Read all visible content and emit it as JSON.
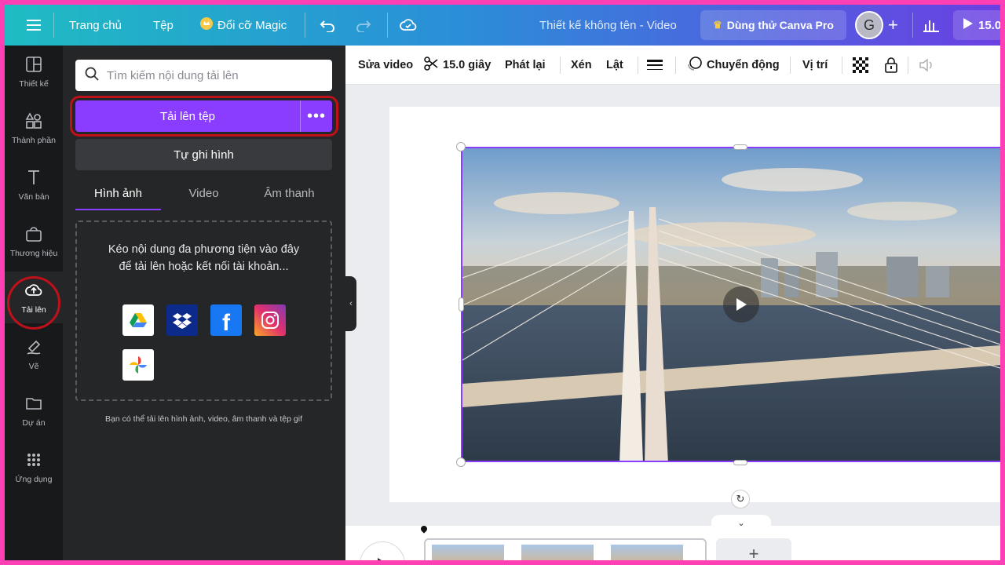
{
  "topbar": {
    "home": "Trang chủ",
    "file": "Tệp",
    "magic": "Đổi cỡ Magic",
    "doc_title": "Thiết kế không tên - Video",
    "pro": "Dùng thử Canva Pro",
    "avatar": "G",
    "share": "15.0"
  },
  "rail": {
    "items": [
      {
        "label": "Thiết kế",
        "icon": "layout-icon"
      },
      {
        "label": "Thành phần",
        "icon": "shapes-icon"
      },
      {
        "label": "Văn bản",
        "icon": "text-icon"
      },
      {
        "label": "Thương hiệu",
        "icon": "brand-icon"
      },
      {
        "label": "Tải lên",
        "icon": "cloud-upload-icon"
      },
      {
        "label": "Vẽ",
        "icon": "draw-icon"
      },
      {
        "label": "Dự án",
        "icon": "folder-icon"
      },
      {
        "label": "Ứng dụng",
        "icon": "apps-grid-icon"
      }
    ],
    "active": "Tải lên"
  },
  "panel": {
    "search_placeholder": "Tìm kiếm nội dung tải lên",
    "upload_button": "Tải lên tệp",
    "more": "•••",
    "record_button": "Tự ghi hình",
    "tabs": [
      "Hình ảnh",
      "Video",
      "Âm thanh"
    ],
    "active_tab": "Hình ảnh",
    "dropzone_text": "Kéo nội dung đa phương tiện vào đây để tải lên hoặc kết nối tài khoản...",
    "sources": [
      "google-drive-icon",
      "dropbox-icon",
      "facebook-icon",
      "instagram-icon",
      "google-photos-icon"
    ],
    "hint": "Bạn có thể tải lên hình ảnh, video, âm thanh và tệp gif"
  },
  "toolbar": {
    "edit_video": "Sửa video",
    "duration": "15.0 giây",
    "playback": "Phát lại",
    "crop": "Xén",
    "flip": "Lật",
    "animate": "Chuyển động",
    "position": "Vị trí"
  },
  "colors": {
    "accent": "#8b3dff",
    "highlight_ring": "#c0101a",
    "panel_bg": "#252627",
    "rail_bg": "#18191b"
  }
}
